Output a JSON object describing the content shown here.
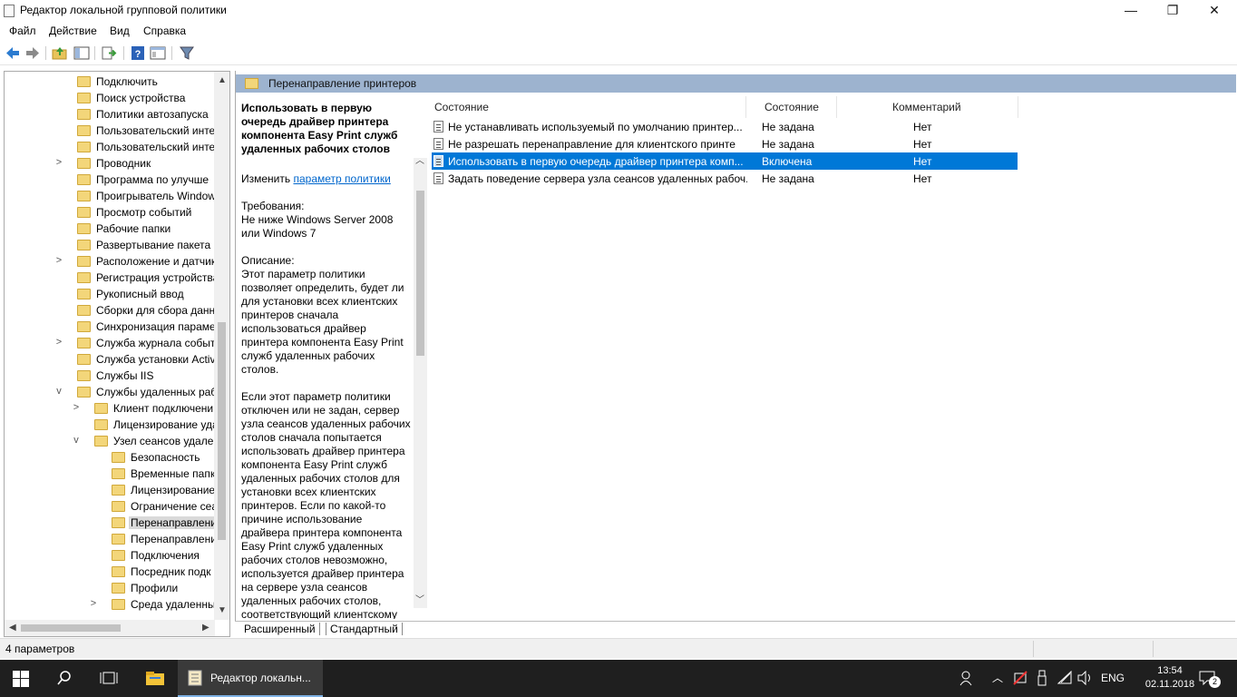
{
  "window": {
    "title": "Редактор локальной групповой политики",
    "minimize": "—",
    "maximize": "❐",
    "close": "✕"
  },
  "menu": [
    "Файл",
    "Действие",
    "Вид",
    "Справка"
  ],
  "tree": {
    "items": [
      {
        "label": "Подключить",
        "exp": ""
      },
      {
        "label": "Поиск устройства",
        "exp": ""
      },
      {
        "label": "Политики автозапуска",
        "exp": ""
      },
      {
        "label": "Пользовательский инте",
        "exp": ""
      },
      {
        "label": "Пользовательский инте",
        "exp": ""
      },
      {
        "label": "Проводник",
        "exp": ">"
      },
      {
        "label": "Программа по улучше",
        "exp": ""
      },
      {
        "label": "Проигрыватель Window",
        "exp": ""
      },
      {
        "label": "Просмотр событий",
        "exp": ""
      },
      {
        "label": "Рабочие папки",
        "exp": ""
      },
      {
        "label": "Развертывание пакета п",
        "exp": ""
      },
      {
        "label": "Расположение и датчик",
        "exp": ">"
      },
      {
        "label": "Регистрация устройства",
        "exp": ""
      },
      {
        "label": "Рукописный ввод",
        "exp": ""
      },
      {
        "label": "Сборки для сбора данн",
        "exp": ""
      },
      {
        "label": "Синхронизация параме",
        "exp": ""
      },
      {
        "label": "Служба журнала событ",
        "exp": ">"
      },
      {
        "label": "Служба установки Activ",
        "exp": ""
      },
      {
        "label": "Службы IIS",
        "exp": ""
      },
      {
        "label": "Службы удаленных раб",
        "exp": "v"
      },
      {
        "label": "Клиент подключени",
        "exp": ">"
      },
      {
        "label": "Лицензирование уда",
        "exp": ""
      },
      {
        "label": "Узел сеансов удален",
        "exp": "v"
      },
      {
        "label": "Безопасность",
        "exp": ""
      },
      {
        "label": "Временные папк",
        "exp": ""
      },
      {
        "label": "Лицензирование",
        "exp": ""
      },
      {
        "label": "Ограничение сеа",
        "exp": ""
      },
      {
        "label": "Перенаправлени",
        "exp": ""
      },
      {
        "label": "Перенаправлени",
        "exp": ""
      },
      {
        "label": "Подключения",
        "exp": ""
      },
      {
        "label": "Посредник подк",
        "exp": ""
      },
      {
        "label": "Профили",
        "exp": ""
      },
      {
        "label": "Среда удаленных",
        "exp": ">"
      }
    ]
  },
  "header": {
    "title": "Перенаправление принтеров"
  },
  "description": {
    "policy_name": "Использовать в первую очередь драйвер принтера компонента Easy Print служб удаленных рабочих столов",
    "edit_prefix": "Изменить ",
    "edit_link": "параметр политики",
    "requirements": "Требования:\nНе ниже Windows Server 2008 или Windows 7",
    "desc1": "Описание:\nЭтот параметр политики позволяет определить, будет ли для установки всех клиентских принтеров сначала использоваться драйвер принтера компонента Easy Print служб удаленных рабочих столов.",
    "desc2": "Если этот параметр политики отключен или не задан, сервер узла сеансов удаленных рабочих столов сначала попытается использовать драйвер принтера компонента Easy Print служб удаленных рабочих столов для установки всех клиентских принтеров. Если по какой-то причине использование драйвера принтера компонента Easy Print служб удаленных рабочих столов невозможно, используется драйвер принтера на сервере узла сеансов удаленных рабочих столов, соответствующий клиентскому"
  },
  "list": {
    "columns": [
      "Состояние",
      "Состояние",
      "Комментарий"
    ],
    "rows": [
      {
        "name": "Не устанавливать используемый по умолчанию принтер...",
        "state": "Не задана",
        "comment": "Нет"
      },
      {
        "name": "Не разрешать перенаправление для клиентского принте",
        "state": "Не задана",
        "comment": "Нет"
      },
      {
        "name": "Использовать в первую очередь драйвер принтера комп...",
        "state": "Включена",
        "comment": "Нет"
      },
      {
        "name": "Задать поведение сервера узла сеансов удаленных рабоч...",
        "state": "Не задана",
        "comment": "Нет"
      }
    ]
  },
  "tabs": [
    "Расширенный",
    "Стандартный"
  ],
  "status": {
    "text": "4 параметров"
  },
  "taskbar": {
    "active_app": "Редактор локальн...",
    "lang": "ENG",
    "time": "13:54",
    "date": "02.11.2018",
    "notifications": "2"
  },
  "colors": {
    "selection": "#0078d7",
    "header": "#9db3cf",
    "taskbar": "#1f1f1f"
  }
}
